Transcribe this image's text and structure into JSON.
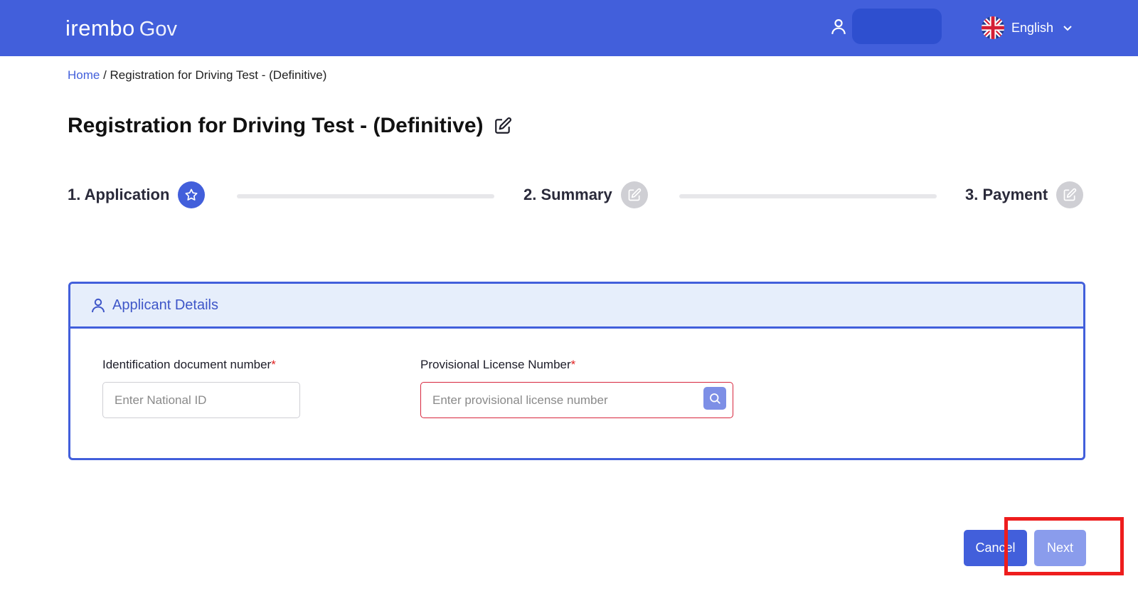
{
  "header": {
    "brand": "irembo",
    "brand_suffix": "Gov",
    "user_icon": "user-icon",
    "language": "English",
    "language_flag": "uk-flag-icon"
  },
  "breadcrumb": {
    "home": "Home",
    "separator": " / ",
    "current": "Registration for Driving Test - (Definitive)"
  },
  "page": {
    "title": "Registration for Driving Test - (Definitive)",
    "title_icon": "edit-icon"
  },
  "stepper": {
    "steps": [
      {
        "label": "1. Application",
        "icon": "star-icon",
        "state": "active"
      },
      {
        "label": "2. Summary",
        "icon": "edit-icon",
        "state": "inactive"
      },
      {
        "label": "3. Payment",
        "icon": "edit-icon",
        "state": "inactive"
      }
    ]
  },
  "card": {
    "title": "Applicant Details",
    "fields": {
      "id_label": "Identification document number",
      "id_placeholder": "Enter National ID",
      "license_label": "Provisional License Number",
      "license_placeholder": "Enter provisional license number",
      "required_mark": "*"
    }
  },
  "actions": {
    "cancel": "Cancel",
    "next": "Next"
  },
  "colors": {
    "primary": "#425fdb",
    "header_bg": "#425fdb",
    "card_head_bg": "#e6eefb",
    "error": "#d7263d",
    "next_disabled": "#8a9cec",
    "highlight": "#ee1d1d"
  }
}
